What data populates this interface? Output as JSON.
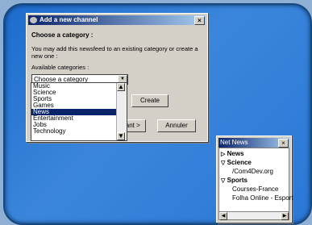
{
  "dialog": {
    "title": "Add a new channel",
    "heading": "Choose a category :",
    "description": "You may add this newsfeed to an existing category or create a new one :",
    "available_label": "Available categories :",
    "combo_value": "Choose a category",
    "list": [
      "Music",
      "Science",
      "Sports",
      "Games",
      "News",
      "Entertainment",
      "Jobs",
      "Technology"
    ],
    "selected_item": "News",
    "create_label": "Create",
    "next_label": "Suivant >",
    "cancel_label": "Annuler"
  },
  "sidebar": {
    "title": "Net News",
    "items": [
      {
        "label": "News",
        "type": "category",
        "expanded": false
      },
      {
        "label": "Science",
        "type": "category",
        "expanded": true
      },
      {
        "label": "/Com4Dev.org",
        "type": "feed"
      },
      {
        "label": "Sports",
        "type": "category",
        "expanded": true
      },
      {
        "label": "Courses-France",
        "type": "feed"
      },
      {
        "label": "Folha Online - Esport",
        "type": "feed"
      }
    ]
  }
}
